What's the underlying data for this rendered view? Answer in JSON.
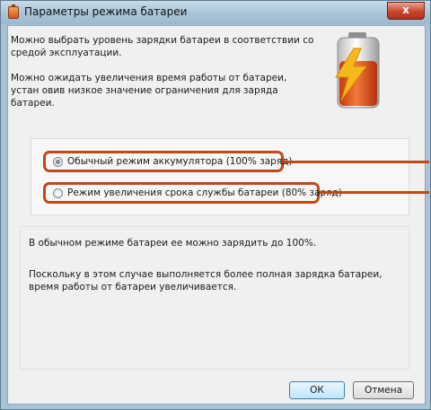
{
  "window": {
    "title": "Параметры режима батареи",
    "close_label": "x"
  },
  "intro": {
    "p1": "Можно выбрать уровень зарядки батареи в соответствии со средой эксплуатации.",
    "p2": "Можно ожидать увеличения время работы от батареи, устан овив низкое значение ограничения для заряда батареи."
  },
  "options": [
    {
      "label": "Обычный режим аккумулятора (100% заряд)",
      "checked": true
    },
    {
      "label": "Режим увеличения срока службы батареи (80% заряд)",
      "checked": false
    }
  ],
  "description": {
    "p1": "В обычном режиме батареи ее можно зарядить до 100%.",
    "p2": "Поскольку в этом случае выполняется более полная зарядка батареи, время работы от батареи увеличивается."
  },
  "buttons": {
    "ok": "ОК",
    "cancel": "Отмена"
  },
  "colors": {
    "highlight": "#c04a16",
    "battery_fill": "#e8541c",
    "bolt": "#f6b81a"
  },
  "icons": {
    "title_icon": "battery-icon",
    "hero_icon": "battery-lightning-icon"
  }
}
